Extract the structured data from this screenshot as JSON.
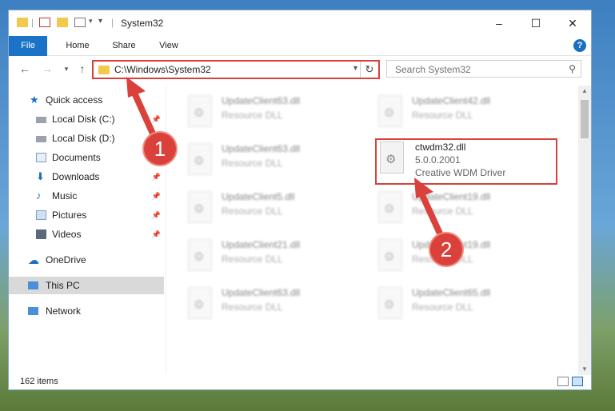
{
  "window": {
    "title": "System32",
    "controls": {
      "minimize": "–",
      "maximize": "☐",
      "close": "✕"
    }
  },
  "ribbon": {
    "tabs": [
      "File",
      "Home",
      "Share",
      "View"
    ],
    "help": "?"
  },
  "address": {
    "path": "C:\\Windows\\System32"
  },
  "search": {
    "placeholder": "Search System32"
  },
  "sidebar": {
    "items": [
      {
        "label": "Quick access",
        "icon": "star-icon",
        "pinned": false
      },
      {
        "label": "Local Disk (C:)",
        "icon": "drive-icon",
        "pinned": true
      },
      {
        "label": "Local Disk (D:)",
        "icon": "drive-icon",
        "pinned": false
      },
      {
        "label": "Documents",
        "icon": "documents-icon",
        "pinned": true
      },
      {
        "label": "Downloads",
        "icon": "download-icon",
        "pinned": true
      },
      {
        "label": "Music",
        "icon": "music-icon",
        "pinned": true
      },
      {
        "label": "Pictures",
        "icon": "pictures-icon",
        "pinned": true
      },
      {
        "label": "Videos",
        "icon": "videos-icon",
        "pinned": true
      },
      {
        "label": "OneDrive",
        "icon": "cloud-icon",
        "pinned": false
      },
      {
        "label": "This PC",
        "icon": "computer-icon",
        "pinned": false,
        "selected": true
      },
      {
        "label": "Network",
        "icon": "network-icon",
        "pinned": false
      }
    ]
  },
  "files": {
    "left": [
      {
        "name": "UpdateClient63.dll",
        "type": "Resource DLL"
      },
      {
        "name": "UpdateClient63.dll",
        "type": "Resource DLL"
      },
      {
        "name": "UpdateClient5.dll",
        "type": "Resource DLL"
      },
      {
        "name": "UpdateClient21.dll",
        "type": "Resource DLL"
      },
      {
        "name": "UpdateClient63.dll",
        "type": "Resource DLL"
      }
    ],
    "right": [
      {
        "name": "UpdateClient42.dll",
        "type": "Resource DLL"
      },
      {
        "name": "UpdateClient19.dll",
        "type": "Resource DLL"
      },
      {
        "name": "UpdateClient19.dll",
        "type": "Resource DLL"
      },
      {
        "name": "UpdateClient65.dll",
        "type": "Resource DLL"
      }
    ],
    "highlighted": {
      "name": "ctwdm32.dll",
      "version": "5.0.0.2001",
      "description": "Creative WDM Driver"
    }
  },
  "status": {
    "item_count": "162 items"
  },
  "annotations": {
    "marker1": "1",
    "marker2": "2",
    "color": "#d9413a"
  }
}
